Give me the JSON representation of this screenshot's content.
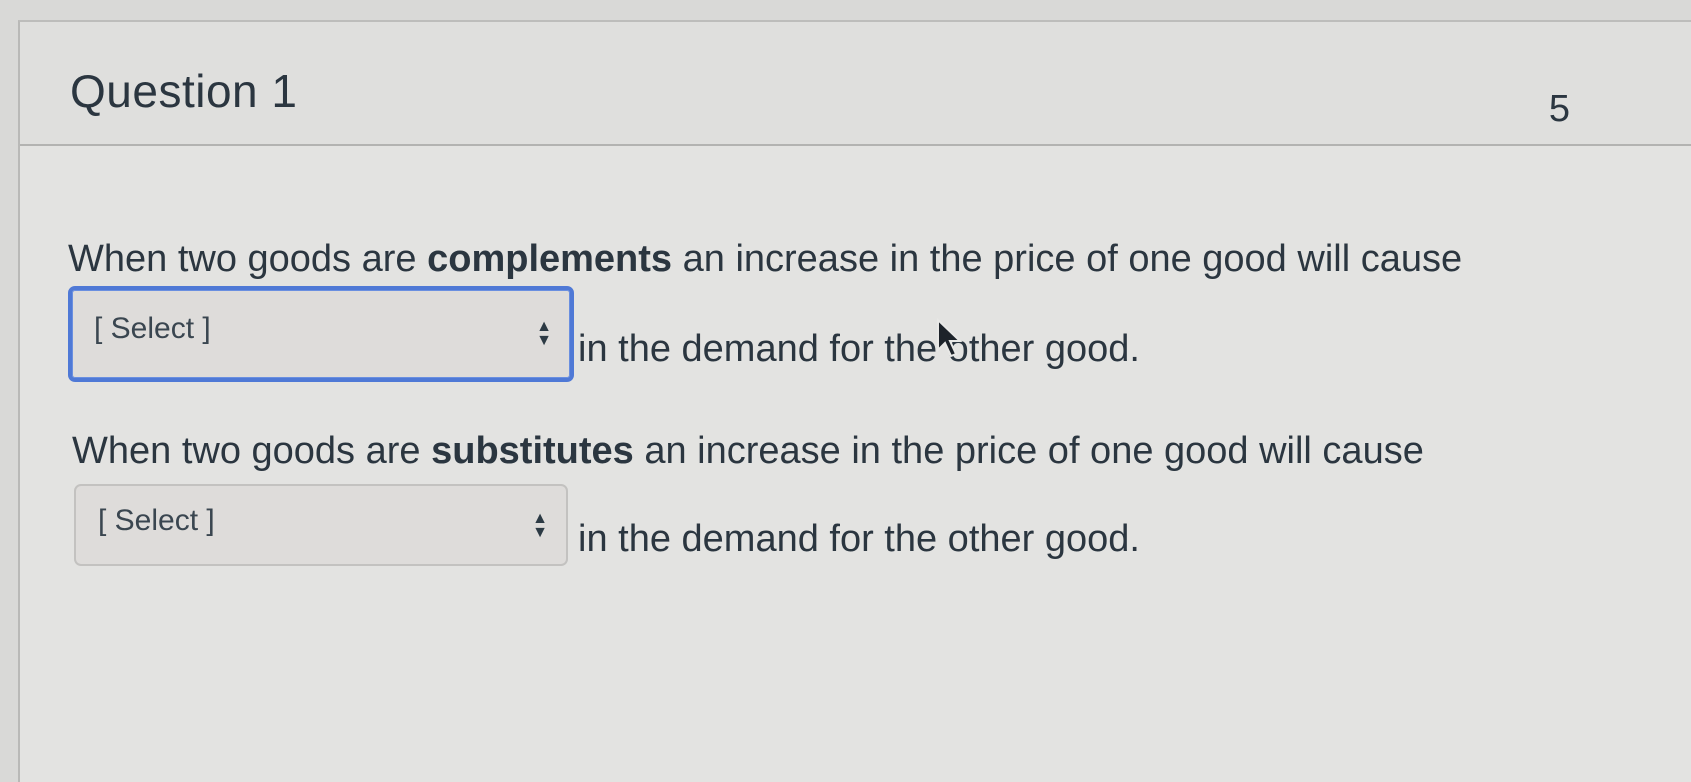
{
  "question": {
    "title": "Question 1",
    "points": "5"
  },
  "items": [
    {
      "prefix": "When two goods are ",
      "keyword": "complements",
      "suffix": " an increase in the price of one good will cause",
      "select_value": "[ Select ]",
      "after": "in the demand for the other good."
    },
    {
      "prefix": "When two goods are ",
      "keyword": "substitutes",
      "suffix": " an increase in the price of one good will cause",
      "select_value": "[ Select ]",
      "after": "in the demand for the other good."
    }
  ],
  "icons": {
    "select_arrows": "up-down-arrows-icon",
    "cursor": "mouse-pointer-icon"
  }
}
